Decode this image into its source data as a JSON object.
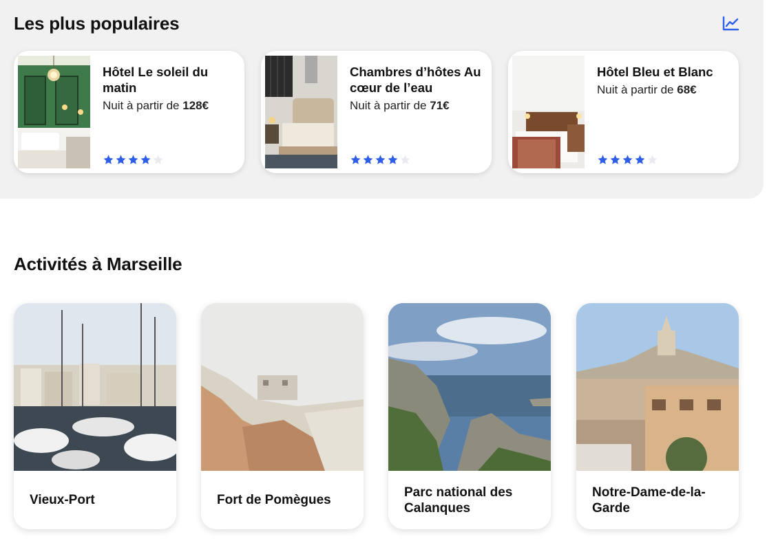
{
  "popular": {
    "title": "Les plus populaires",
    "hotels": [
      {
        "name": "Hôtel Le soleil du matin",
        "price_prefix": "Nuit à partir de ",
        "price_value": "128€",
        "rating": 4,
        "max_rating": 5
      },
      {
        "name": "Chambres d’hôtes Au cœur de l’eau",
        "price_prefix": "Nuit à partir de ",
        "price_value": "71€",
        "rating": 4,
        "max_rating": 5
      },
      {
        "name": "Hôtel Bleu et Blanc",
        "price_prefix": "Nuit à partir de ",
        "price_value": "68€",
        "rating": 4,
        "max_rating": 5
      }
    ]
  },
  "activities": {
    "title": "Activités à Marseille",
    "items": [
      {
        "label": "Vieux-Port"
      },
      {
        "label": "Fort de Pomègues"
      },
      {
        "label": "Parc national des Calanques"
      },
      {
        "label": "Notre-Dame-de-la-Garde"
      }
    ]
  },
  "icons": {
    "trend": "chart-line-icon",
    "star": "star-icon"
  },
  "colors": {
    "accent": "#2f5ee8",
    "section_bg": "#f1f1f1",
    "star_empty": "#e9ebef"
  }
}
